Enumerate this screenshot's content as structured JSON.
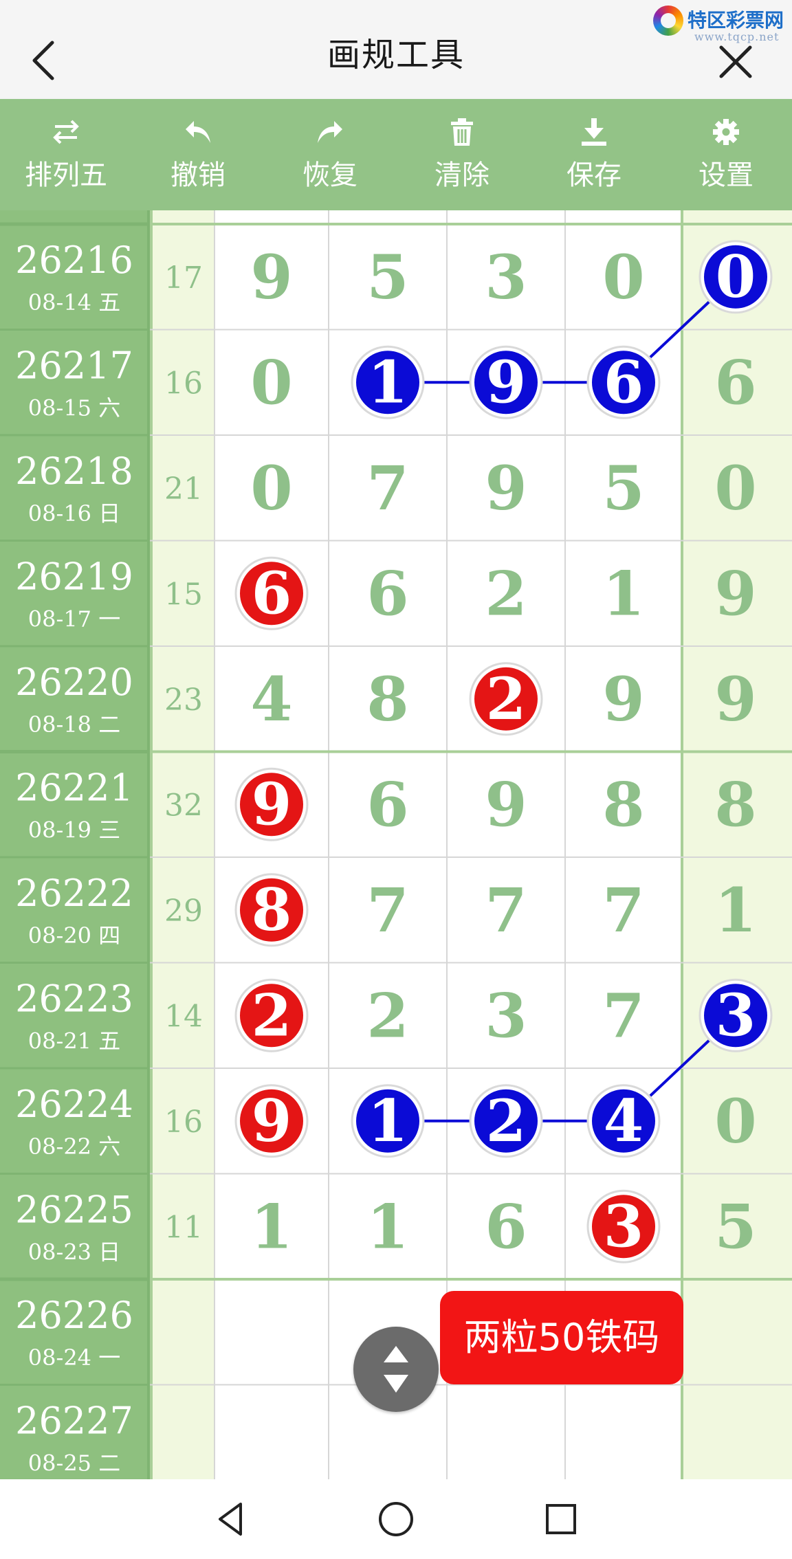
{
  "titlebar": {
    "title": "画规工具",
    "brand_name": "特区彩票网",
    "brand_url": "www.tqcp.net"
  },
  "toolbar": [
    {
      "label": "排列五",
      "icon": "swap-arrows-icon"
    },
    {
      "label": "撤销",
      "icon": "undo-icon"
    },
    {
      "label": "恢复",
      "icon": "redo-icon"
    },
    {
      "label": "清除",
      "icon": "trash-icon"
    },
    {
      "label": "保存",
      "icon": "download-icon"
    },
    {
      "label": "设置",
      "icon": "gear-icon"
    }
  ],
  "rows": [
    {
      "issue": "26216",
      "date": "08-14 五",
      "sum": "17",
      "digits": [
        "9",
        "5",
        "3",
        "0",
        "0"
      ]
    },
    {
      "issue": "26217",
      "date": "08-15 六",
      "sum": "16",
      "digits": [
        "0",
        "1",
        "9",
        "6",
        "6"
      ]
    },
    {
      "issue": "26218",
      "date": "08-16 日",
      "sum": "21",
      "digits": [
        "0",
        "7",
        "9",
        "5",
        "0"
      ]
    },
    {
      "issue": "26219",
      "date": "08-17 一",
      "sum": "15",
      "digits": [
        "6",
        "6",
        "2",
        "1",
        "9"
      ]
    },
    {
      "issue": "26220",
      "date": "08-18 二",
      "sum": "23",
      "digits": [
        "4",
        "8",
        "2",
        "9",
        "9"
      ]
    },
    {
      "issue": "26221",
      "date": "08-19 三",
      "sum": "32",
      "digits": [
        "9",
        "6",
        "9",
        "8",
        "8"
      ]
    },
    {
      "issue": "26222",
      "date": "08-20 四",
      "sum": "29",
      "digits": [
        "8",
        "7",
        "7",
        "7",
        "1"
      ]
    },
    {
      "issue": "26223",
      "date": "08-21 五",
      "sum": "14",
      "digits": [
        "2",
        "2",
        "3",
        "7",
        "3"
      ]
    },
    {
      "issue": "26224",
      "date": "08-22 六",
      "sum": "16",
      "digits": [
        "9",
        "1",
        "2",
        "4",
        "0"
      ]
    },
    {
      "issue": "26225",
      "date": "08-23 日",
      "sum": "11",
      "digits": [
        "1",
        "1",
        "6",
        "3",
        "5"
      ]
    },
    {
      "issue": "26226",
      "date": "08-24 一",
      "sum": "",
      "digits": [
        "",
        "",
        "",
        "",
        ""
      ]
    },
    {
      "issue": "26227",
      "date": "08-25 二",
      "sum": "",
      "digits": [
        "",
        "",
        "",
        "",
        ""
      ]
    }
  ],
  "marks": [
    {
      "row": 0,
      "col": 4,
      "color": "blue"
    },
    {
      "row": 1,
      "col": 1,
      "color": "blue"
    },
    {
      "row": 1,
      "col": 2,
      "color": "blue"
    },
    {
      "row": 1,
      "col": 3,
      "color": "blue"
    },
    {
      "row": 3,
      "col": 0,
      "color": "red"
    },
    {
      "row": 4,
      "col": 2,
      "color": "red"
    },
    {
      "row": 5,
      "col": 0,
      "color": "red"
    },
    {
      "row": 6,
      "col": 0,
      "color": "red"
    },
    {
      "row": 7,
      "col": 0,
      "color": "red"
    },
    {
      "row": 7,
      "col": 4,
      "color": "blue"
    },
    {
      "row": 8,
      "col": 0,
      "color": "red"
    },
    {
      "row": 8,
      "col": 1,
      "color": "blue"
    },
    {
      "row": 8,
      "col": 2,
      "color": "blue"
    },
    {
      "row": 8,
      "col": 3,
      "color": "blue"
    },
    {
      "row": 9,
      "col": 3,
      "color": "red"
    }
  ],
  "connectors": [
    [
      [
        0,
        4
      ],
      [
        1,
        3
      ],
      [
        1,
        2
      ],
      [
        1,
        1
      ]
    ],
    [
      [
        7,
        4
      ],
      [
        8,
        3
      ],
      [
        8,
        2
      ],
      [
        8,
        1
      ]
    ]
  ],
  "colors": {
    "toolbar_bg": "#93c387",
    "left_col_bg": "#8ec07f",
    "sum_col_bg": "#f1f8df",
    "last_col_bg": "#f1f8df",
    "digit_green": "#8fc08a",
    "ball_red": "#e41515",
    "ball_blue": "#0b0bd6",
    "fab_bg": "#6b6b6b",
    "tag_bg": "#f21515"
  },
  "floating": {
    "tag_label": "两粒50铁码",
    "fab_icon": "scroll-up-down-icon"
  },
  "navbar": [
    {
      "icon": "back-triangle-icon"
    },
    {
      "icon": "home-circle-icon"
    },
    {
      "icon": "recents-square-icon"
    }
  ]
}
